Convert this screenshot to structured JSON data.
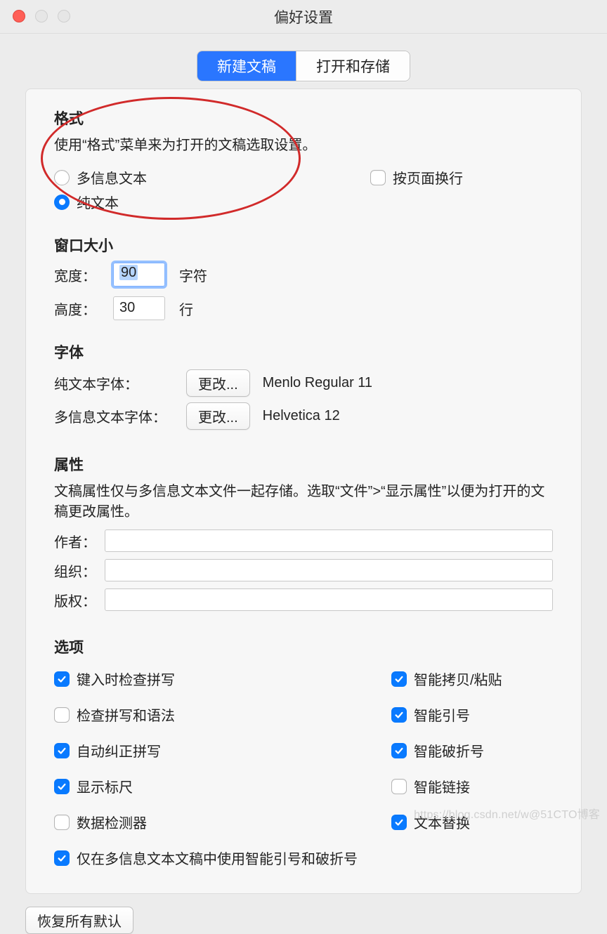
{
  "window": {
    "title": "偏好设置"
  },
  "tabs": {
    "new_doc": "新建文稿",
    "open_save": "打开和存储",
    "selected": "new_doc"
  },
  "format": {
    "title": "格式",
    "desc": "使用“格式”菜单来为打开的文稿选取设置。",
    "rich_label": "多信息文本",
    "plain_label": "纯文本",
    "selected": "plain",
    "wrap_label": "按页面换行",
    "wrap_checked": false
  },
  "window_size": {
    "title": "窗口大小",
    "width_label": "宽度：",
    "height_label": "高度：",
    "width_value": "90",
    "height_value": "30",
    "chars_unit": "字符",
    "lines_unit": "行"
  },
  "fonts": {
    "title": "字体",
    "plain_label": "纯文本字体：",
    "rich_label": "多信息文本字体：",
    "change_btn": "更改...",
    "plain_name": "Menlo Regular 11",
    "rich_name": "Helvetica 12"
  },
  "attributes": {
    "title": "属性",
    "desc": "文稿属性仅与多信息文本文件一起存储。选取“文件”>“显示属性”以便为打开的文稿更改属性。",
    "author_label": "作者：",
    "org_label": "组织：",
    "copyright_label": "版权：",
    "author_value": "",
    "org_value": "",
    "copyright_value": ""
  },
  "options": {
    "title": "选项",
    "left": [
      {
        "label": "键入时检查拼写",
        "checked": true
      },
      {
        "label": "检查拼写和语法",
        "checked": false
      },
      {
        "label": "自动纠正拼写",
        "checked": true
      },
      {
        "label": "显示标尺",
        "checked": true
      },
      {
        "label": "数据检测器",
        "checked": false
      },
      {
        "label": "仅在多信息文本文稿中使用智能引号和破折号",
        "checked": true
      }
    ],
    "right": [
      {
        "label": "智能拷贝/粘贴",
        "checked": true
      },
      {
        "label": "智能引号",
        "checked": true
      },
      {
        "label": "智能破折号",
        "checked": true
      },
      {
        "label": "智能链接",
        "checked": false
      },
      {
        "label": "文本替换",
        "checked": true
      }
    ]
  },
  "restore_defaults": "恢复所有默认",
  "watermark": "https://blog.csdn.net/w@51CTO博客"
}
